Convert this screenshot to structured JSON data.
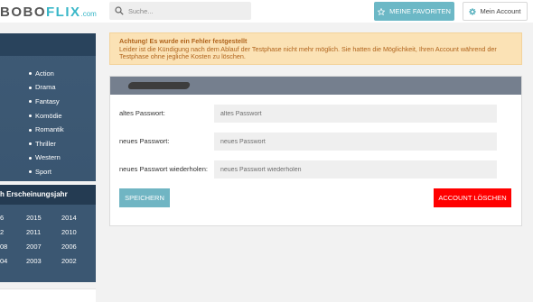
{
  "header": {
    "logo": {
      "part1": "BOBO",
      "part2": "FLIX",
      "part3": ".com"
    },
    "search_placeholder": "Suche...",
    "favorites_label": "MEINE FAVORITEN",
    "account_label": "Mein Account"
  },
  "sidebar": {
    "genres": [
      "Action",
      "Drama",
      "Fantasy",
      "Komödie",
      "Romantik",
      "Thriller",
      "Western",
      "Sport"
    ],
    "year_header": "h Erscheinungsjahr",
    "years": [
      [
        "6",
        "2015",
        "2014"
      ],
      [
        "2",
        "2011",
        "2010"
      ],
      [
        "08",
        "2007",
        "2006"
      ],
      [
        "04",
        "2003",
        "2002"
      ]
    ]
  },
  "alert": {
    "title": "Achtung! Es wurde ein Fehler festgestellt",
    "message": "Leider ist die Kündigung nach dem Ablauf der Testphase nicht mehr möglich. Sie hatten die Möglichkeit, Ihren Account während der Testphase ohne jegliche Kosten zu löschen."
  },
  "form": {
    "fields": [
      {
        "label": "altes Passwort:",
        "placeholder": "altes Passwort"
      },
      {
        "label": "neues Passwort:",
        "placeholder": "neues Passwort"
      },
      {
        "label": "neues Passwort wiederholen:",
        "placeholder": "neues Passwort wiederholen"
      }
    ],
    "save_label": "SPEICHERN",
    "delete_label": "ACCOUNT LÖSCHEN"
  },
  "colors": {
    "accent": "#6cb8c6",
    "sidebar": "#3b5772",
    "danger": "#ff0000",
    "alert_bg": "#fbe2b5"
  }
}
